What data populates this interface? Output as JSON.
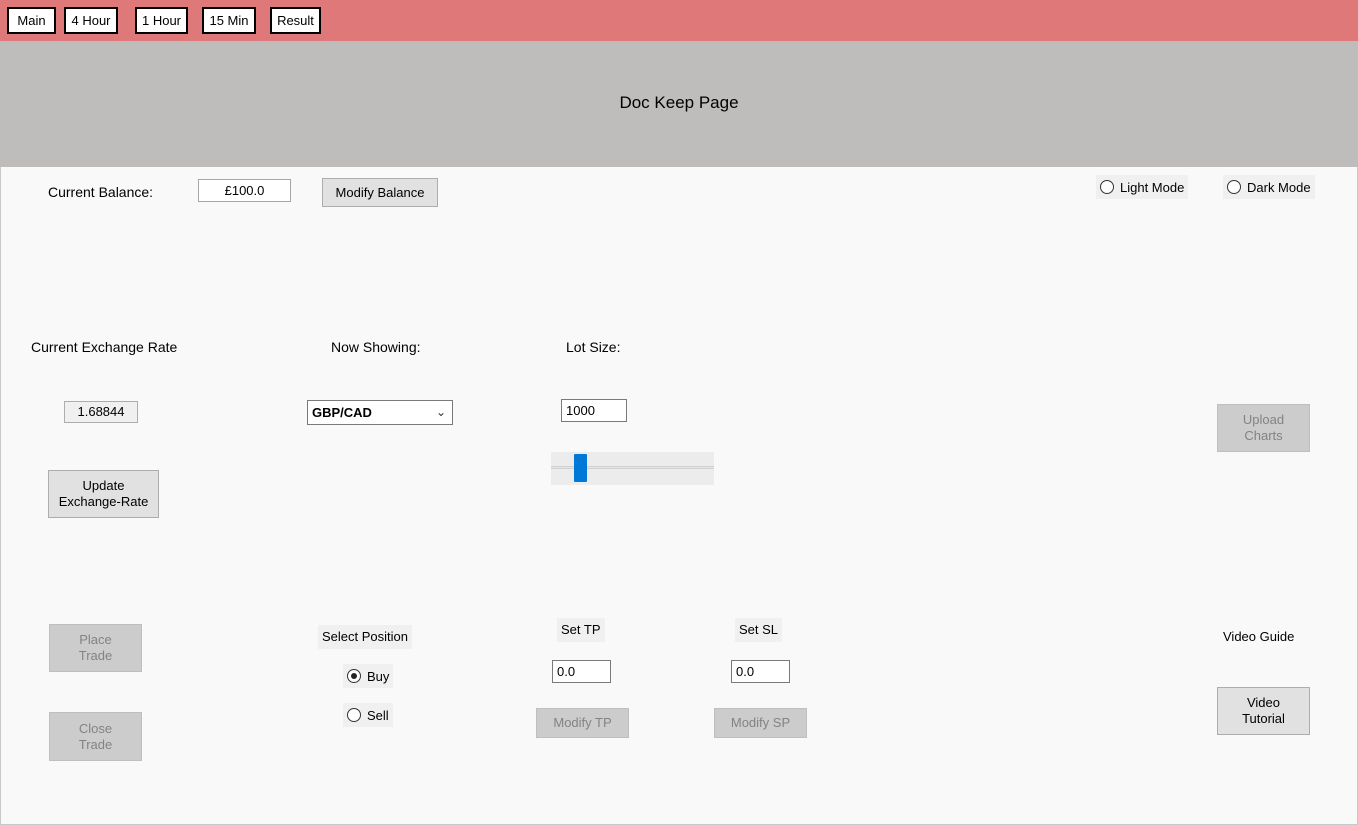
{
  "nav": {
    "tabs": [
      "Main",
      "4 Hour",
      "1 Hour",
      "15 Min",
      "Result"
    ]
  },
  "header": {
    "title": "Doc Keep Page"
  },
  "balance": {
    "label": "Current Balance:",
    "value": "£100.0",
    "modify_button": "Modify Balance"
  },
  "theme": {
    "light_label": "Light Mode",
    "dark_label": "Dark Mode",
    "light_checked": false,
    "dark_checked": false
  },
  "exchange": {
    "label": "Current Exchange Rate",
    "value": "1.68844",
    "update_button_line1": "Update",
    "update_button_line2": "Exchange-Rate"
  },
  "pair": {
    "label": "Now Showing:",
    "selected": "GBP/CAD",
    "chevron_icon": "chevron-down-icon"
  },
  "lot": {
    "label": "Lot Size:",
    "value": "1000",
    "slider_fraction": 0.13
  },
  "upload": {
    "line1": "Upload",
    "line2": "Charts"
  },
  "trade": {
    "place_line1": "Place",
    "place_line2": "Trade",
    "close_line1": "Close",
    "close_line2": "Trade"
  },
  "position": {
    "label": "Select Position",
    "buy_label": "Buy",
    "sell_label": "Sell",
    "selected": "Buy"
  },
  "tp": {
    "label": "Set TP",
    "value": "0.0",
    "button": "Modify TP"
  },
  "sl": {
    "label": "Set SL",
    "value": "0.0",
    "button": "Modify SP"
  },
  "video": {
    "label": "Video Guide",
    "button_line1": "Video",
    "button_line2": "Tutorial"
  }
}
